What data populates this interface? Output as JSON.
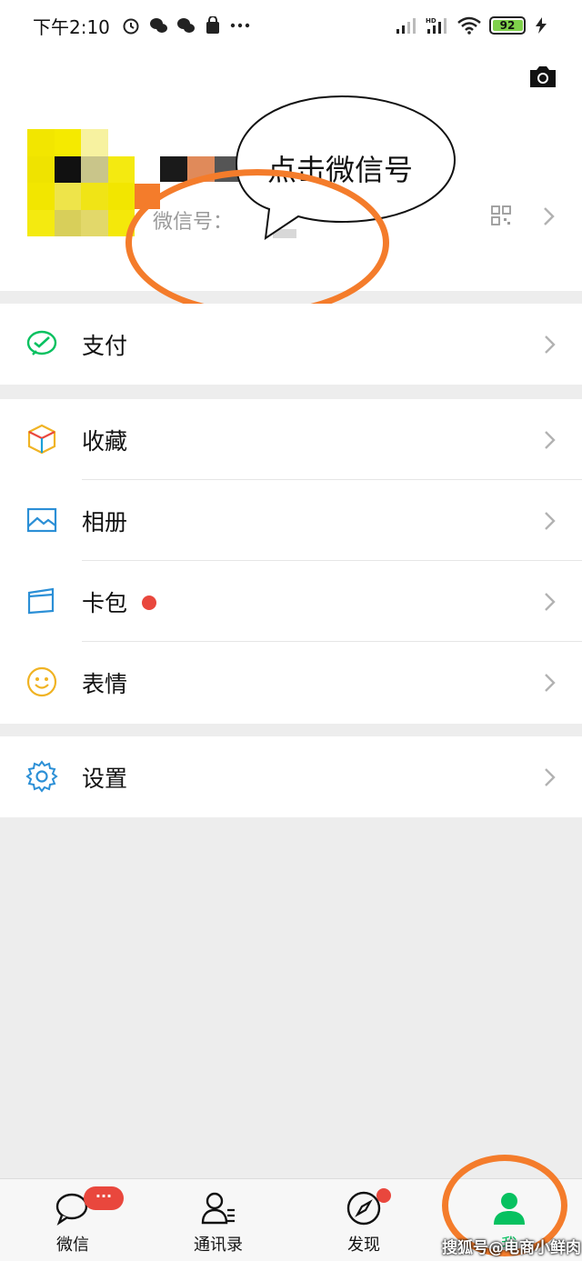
{
  "status_bar": {
    "time": "下午2:10",
    "battery": "92",
    "network": "HD"
  },
  "profile": {
    "wechat_id_label": "微信号：",
    "annotation_text": "点击微信号"
  },
  "menu": {
    "pay": "支付",
    "favorites": "收藏",
    "album": "相册",
    "cards": "卡包",
    "stickers": "表情",
    "settings": "设置"
  },
  "tabbar": {
    "chats": "微信",
    "chats_badge": "···",
    "contacts": "通讯录",
    "discover": "发现",
    "me": "我"
  },
  "watermark": "搜狐号@电商小鲜肉",
  "colors": {
    "wechat_green": "#07c160",
    "badge_red": "#e9473d",
    "annotation_orange": "#f47c2b"
  }
}
